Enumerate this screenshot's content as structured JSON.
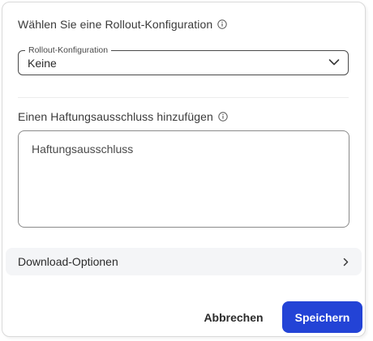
{
  "rollout": {
    "heading": "Wählen Sie eine Rollout-Konfiguration",
    "select_label": "Rollout-Konfiguration",
    "select_value": "Keine"
  },
  "disclaimer": {
    "heading": "Einen Haftungsausschluss hinzufügen",
    "placeholder": "Haftungsausschluss"
  },
  "download": {
    "label": "Download-Optionen"
  },
  "footer": {
    "cancel_label": "Abbrechen",
    "save_label": "Speichern"
  },
  "colors": {
    "primary": "#2343d6",
    "accordion_bg": "#f4f5f7"
  },
  "icons": {
    "info": "info-circle-icon",
    "select": "chevron-down-icon",
    "accordion": "chevron-right-icon"
  }
}
